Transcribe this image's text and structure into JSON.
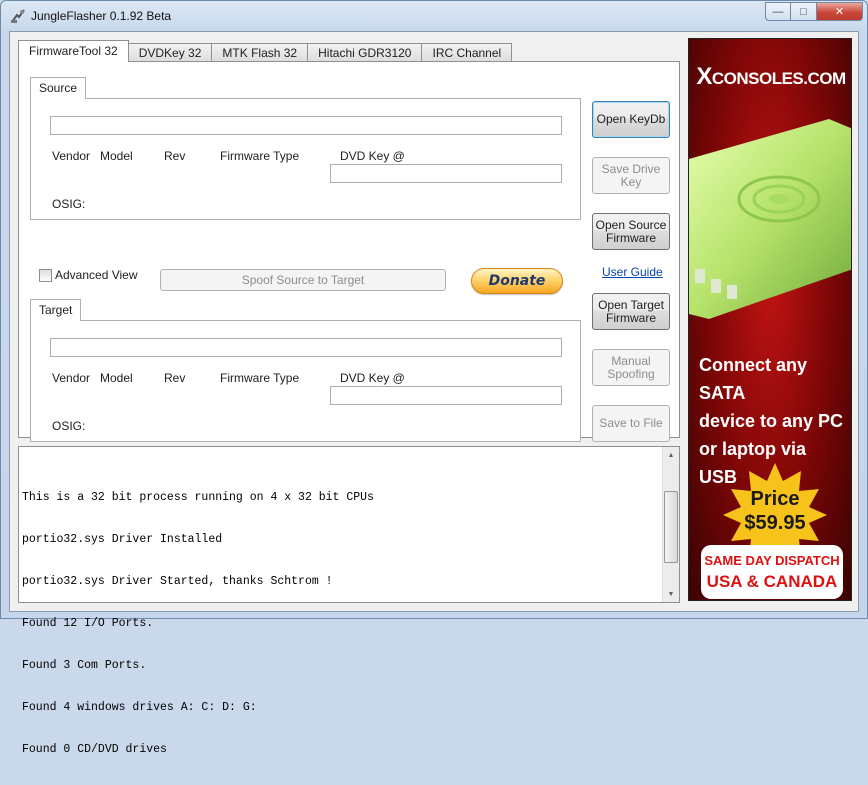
{
  "window": {
    "title": "JungleFlasher 0.1.92 Beta",
    "caption": {
      "minimize": "—",
      "maximize": "□",
      "close": "✕"
    }
  },
  "tabs": [
    {
      "label": "FirmwareTool 32",
      "active": true
    },
    {
      "label": "DVDKey 32"
    },
    {
      "label": "MTK Flash 32"
    },
    {
      "label": "Hitachi GDR3120"
    },
    {
      "label": "IRC Channel"
    }
  ],
  "source": {
    "group_label": "Source",
    "drive_value": "",
    "headers": {
      "vendor": "Vendor",
      "model": "Model",
      "rev": "Rev",
      "firmware_type": "Firmware Type",
      "dvd_key": "DVD Key @"
    },
    "dvd_key_value": "",
    "osig_label": "OSIG:"
  },
  "target": {
    "group_label": "Target",
    "drive_value": "",
    "headers": {
      "vendor": "Vendor",
      "model": "Model",
      "rev": "Rev",
      "firmware_type": "Firmware Type",
      "dvd_key": "DVD Key @"
    },
    "dvd_key_value": "",
    "osig_label": "OSIG:"
  },
  "options": {
    "advanced_view_label": "Advanced View",
    "advanced_view_checked": false,
    "spoof_button": "Spoof Source to Target",
    "donate_button": "Donate",
    "user_guide_link": "User Guide"
  },
  "side_buttons": {
    "open_keydb": "Open  KeyDb",
    "save_drive_key": "Save Drive Key",
    "open_source_firmware": "Open Source Firmware",
    "open_target_firmware": "Open Target Firmware",
    "manual_spoofing": "Manual Spoofing",
    "save_to_file": "Save to File"
  },
  "log": {
    "lines": [
      "This is a 32 bit process running on 4 x 32 bit CPUs",
      "portio32.sys Driver Installed",
      "portio32.sys Driver Started, thanks Schtrom !",
      "Found 12 I/O Ports.",
      "Found 3 Com Ports.",
      "Found 4 windows drives A: C: D: G:",
      "Found 0 CD/DVD drives"
    ]
  },
  "ad": {
    "logo_x": "X",
    "logo_rest": "CONSOLES.COM",
    "tagline": [
      "Connect any SATA",
      "device to any PC",
      "or laptop via USB"
    ],
    "price_label": "Price",
    "price_value": "$59.95",
    "banner_line1": "SAME DAY DISPATCH",
    "banner_line2": "USA & CANADA"
  },
  "colors": {
    "link": "#0645ad",
    "ad_red": "#c41414",
    "price_yellow": "#f7c21a",
    "donate_gold": "#f6a623"
  }
}
